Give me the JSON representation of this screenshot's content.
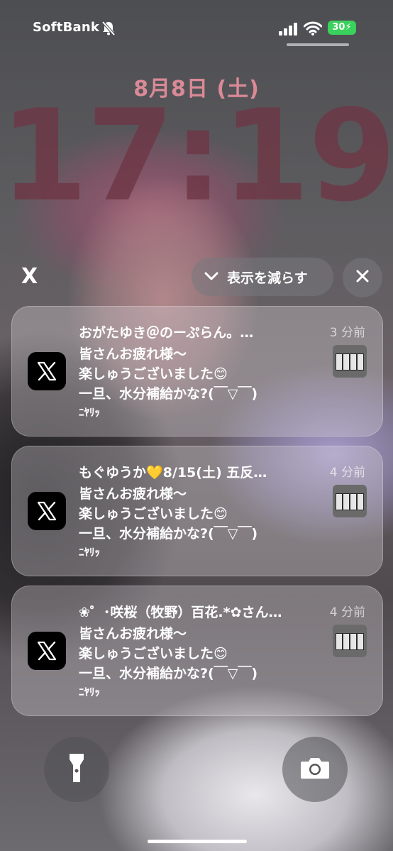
{
  "status_bar": {
    "carrier": "SoftBank",
    "battery": "30"
  },
  "lock": {
    "date": "8月8日 (土)",
    "time": "17:19"
  },
  "stack": {
    "app_label": "X",
    "show_less_label": "表示を減らす"
  },
  "notifications": [
    {
      "title": "おがたゆき＠のーぷらん。…",
      "time": "3 分前",
      "lines": [
        "皆さんお疲れ様〜",
        "楽しゅうございました😊",
        "一旦、水分補給かな?(￣▽￣)",
        "ﾆﾔﾘｯ"
      ]
    },
    {
      "title": "もぐゆうか💛8/15(土) 五反…",
      "time": "4 分前",
      "lines": [
        "皆さんお疲れ様〜",
        "楽しゅうございました😊",
        "一旦、水分補給かな?(￣▽￣)",
        "ﾆﾔﾘｯ"
      ]
    },
    {
      "title": "❀゜･咲桜（牧野）百花.*✿さん…",
      "time": "4 分前",
      "lines": [
        "皆さんお疲れ様〜",
        "楽しゅうございました😊",
        "一旦、水分補給かな?(￣▽￣)",
        "ﾆﾔﾘｯ"
      ]
    }
  ],
  "icons": {
    "mute": "bell-slash-icon",
    "signal": "cellular-signal-icon",
    "wifi": "wifi-icon",
    "app": "x-logo-icon",
    "flashlight": "flashlight-icon",
    "camera": "camera-icon"
  },
  "colors": {
    "date": "#d98a96",
    "time": "#6e3746",
    "battery": "#3ad15c"
  }
}
